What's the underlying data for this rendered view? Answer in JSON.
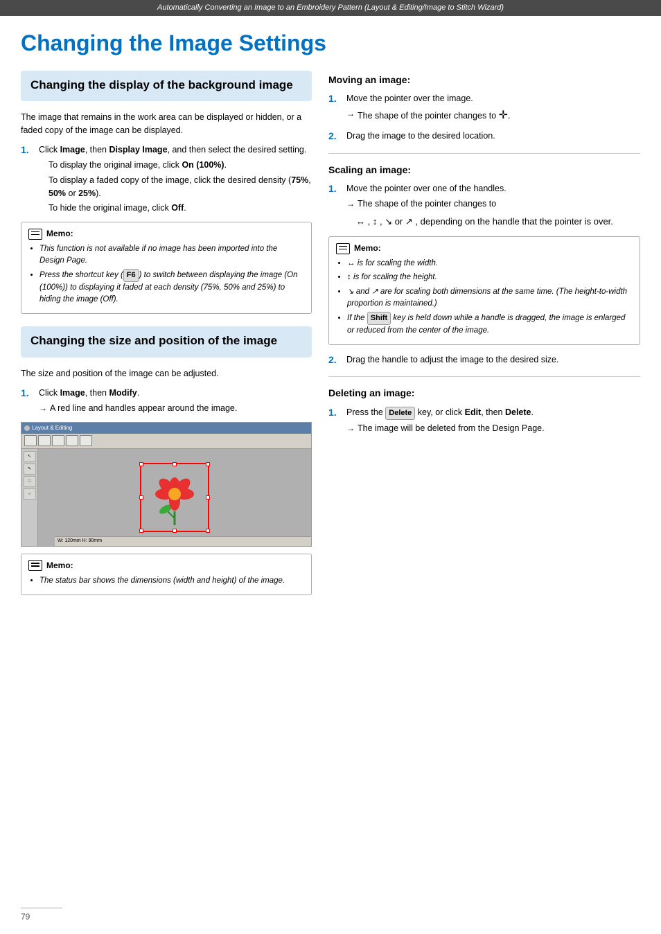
{
  "topbar": {
    "text": "Automatically Converting an Image to an Embroidery Pattern (Layout & Editing/Image to Stitch Wizard)"
  },
  "page": {
    "title": "Changing the Image Settings",
    "footer_page": "79"
  },
  "left_col": {
    "section1": {
      "title": "Changing the display of the background image",
      "intro": "The image that remains in the work area can be displayed or hidden, or a faded copy of the image can be displayed.",
      "step1": {
        "number": "1.",
        "text": "Click Image, then Display Image, and then select the desired setting.",
        "sub1": "To display the original image, click On (100%).",
        "sub2": "To display a faded copy of the image, click the desired density (75%, 50% or 25%).",
        "sub3": "To hide the original image, click Off."
      },
      "memo": {
        "title": "Memo:",
        "items": [
          "This function is not available if no image has been imported into the Design Page.",
          "Press the shortcut key (F6) to switch between displaying the image (On (100%)) to displaying it faded at each density (75%, 50% and 25%) to hiding the image (Off)."
        ]
      }
    },
    "section2": {
      "title": "Changing the size and position of the image",
      "intro": "The size and position of the image can be adjusted.",
      "step1": {
        "number": "1.",
        "text": "Click Image, then Modify.",
        "arrow": "A red line and handles appear around the image."
      },
      "memo2": {
        "title": "Memo:",
        "items": [
          "The status bar shows the dimensions (width and height) of the image."
        ]
      }
    }
  },
  "right_col": {
    "moving": {
      "title": "Moving an image:",
      "step1": {
        "number": "1.",
        "text": "Move the pointer over the image.",
        "arrow": "The shape of the pointer changes to"
      },
      "step2": {
        "number": "2.",
        "text": "Drag the image to the desired location."
      }
    },
    "scaling": {
      "title": "Scaling an image:",
      "step1": {
        "number": "1.",
        "text": "Move the pointer over one of the handles.",
        "arrow": "The shape of the pointer changes to",
        "arrow2": "depending on the handle that the pointer is over."
      },
      "memo": {
        "title": "Memo:",
        "items": [
          "↔ is for scaling the width.",
          "↕ is for scaling the height.",
          "↘ and ↗ are for scaling both dimensions at the same time. (The height-to-width proportion is maintained.)",
          "If the Shift key is held down while a handle is dragged, the image is enlarged or reduced from the center of the image."
        ]
      },
      "step2": {
        "number": "2.",
        "text": "Drag the handle to adjust the image to the desired size."
      }
    },
    "deleting": {
      "title": "Deleting an image:",
      "step1": {
        "number": "1.",
        "text": "Press the Delete key, or click Edit, then Delete.",
        "arrow": "The image will be deleted from the Design Page."
      }
    }
  }
}
